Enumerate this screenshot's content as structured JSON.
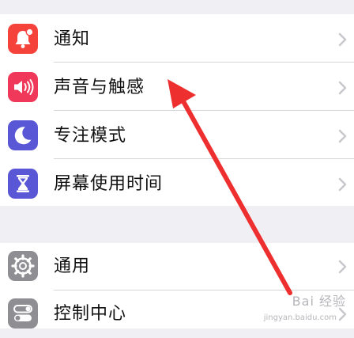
{
  "settings": {
    "group1": [
      {
        "label": "通知",
        "icon": "bell-badge-icon",
        "icon_color": "#f5433c"
      },
      {
        "label": "声音与触感",
        "icon": "speaker-icon",
        "icon_color": "#f0385a"
      },
      {
        "label": "专注模式",
        "icon": "moon-icon",
        "icon_color": "#5a57d6"
      },
      {
        "label": "屏幕使用时间",
        "icon": "hourglass-icon",
        "icon_color": "#5a57d6"
      }
    ],
    "group2": [
      {
        "label": "通用",
        "icon": "gear-icon",
        "icon_color": "#8e8e93"
      },
      {
        "label": "控制中心",
        "icon": "toggle-switches-icon",
        "icon_color": "#8e8e93"
      }
    ]
  },
  "annotation": {
    "arrow_color": "#ee2f2f"
  },
  "watermark": {
    "text": "Bai 经验",
    "url": "jingyan.baidu.com"
  }
}
